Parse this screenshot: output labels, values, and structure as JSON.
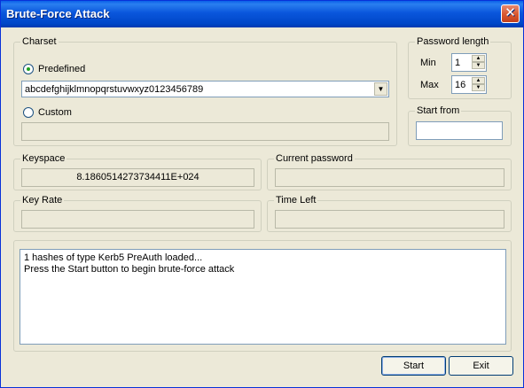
{
  "window": {
    "title": "Brute-Force Attack"
  },
  "icons": {
    "close": "close-icon"
  },
  "charset": {
    "legend": "Charset",
    "predefined_label": "Predefined",
    "predefined_selected": true,
    "predefined_value": "abcdefghijklmnopqrstuvwxyz0123456789",
    "custom_label": "Custom",
    "custom_selected": false,
    "custom_value": ""
  },
  "password_length": {
    "legend": "Password length",
    "min_label": "Min",
    "min_value": "1",
    "max_label": "Max",
    "max_value": "16"
  },
  "start_from": {
    "legend": "Start from",
    "value": ""
  },
  "keyspace": {
    "legend": "Keyspace",
    "value": "8.1860514273734411E+024"
  },
  "current_password": {
    "legend": "Current password",
    "value": ""
  },
  "key_rate": {
    "legend": "Key Rate",
    "value": ""
  },
  "time_left": {
    "legend": "Time Left",
    "value": ""
  },
  "log": {
    "lines": [
      "1 hashes of type Kerb5 PreAuth loaded...",
      "Press the Start button to begin brute-force attack"
    ]
  },
  "buttons": {
    "start": "Start",
    "exit": "Exit"
  }
}
